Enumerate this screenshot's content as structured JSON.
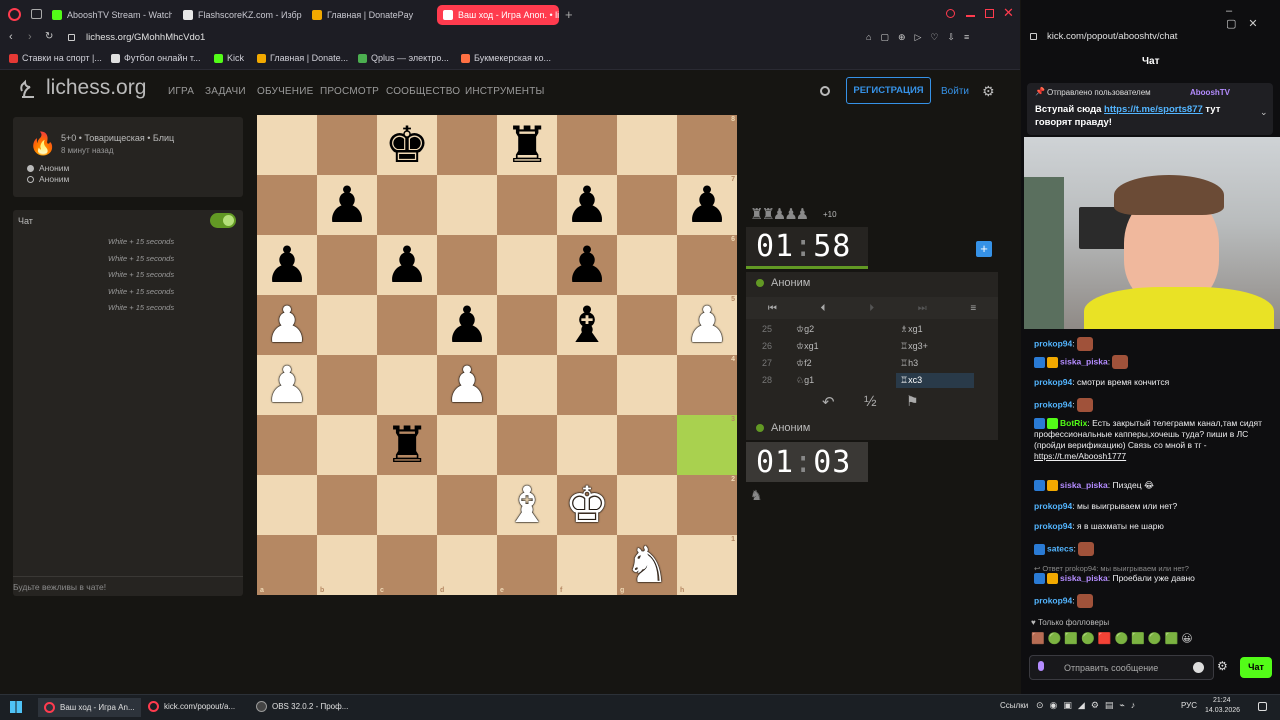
{
  "browser": {
    "tabs": [
      {
        "label": "AbooshTV Stream - Watch",
        "color": "#53fc18"
      },
      {
        "label": "FlashscoreKZ.com - Избр",
        "color": "#e8e8e8"
      },
      {
        "label": "Главная | DonatePay",
        "color": "#f2a900"
      },
      {
        "label": "Ваш ход - Игра Anon. • li",
        "color": "#ffffff"
      }
    ],
    "url": "lichess.org/GMohhMhcVdo1",
    "bookmarks": [
      {
        "label": "Ставки на спорт |...",
        "color": "#e53935"
      },
      {
        "label": "Футбол онлайн т...",
        "color": "#e0e0e0"
      },
      {
        "label": "Kick",
        "color": "#53fc18"
      },
      {
        "label": "Главная | Donate...",
        "color": "#f2a900"
      },
      {
        "label": "Qplus — электро...",
        "color": "#4caf50"
      },
      {
        "label": "Букмекерская ко...",
        "color": "#ff7043"
      }
    ]
  },
  "site": {
    "logo": "lichess.org",
    "nav": [
      "ИГРА",
      "ЗАДАЧИ",
      "ОБУЧЕНИЕ",
      "ПРОСМОТР",
      "СООБЩЕСТВО",
      "ИНСТРУМЕНТЫ"
    ],
    "register": "РЕГИСТРАЦИЯ",
    "login": "Войти"
  },
  "game": {
    "mode": "5+0 • Товарищеская • Блиц",
    "ago": "8 минут назад",
    "white": "Аноним",
    "black": "Аноним"
  },
  "chat": {
    "title": "Чат",
    "messages": [
      "White + 15 seconds",
      "White + 15 seconds",
      "White + 15 seconds",
      "White + 15 seconds",
      "White + 15 seconds"
    ],
    "placeholder": "Будьте вежливы в чате!"
  },
  "board": {
    "colors": {
      "light": "#f0d9b5",
      "dark": "#b58863",
      "highlight": "#a9d14f"
    },
    "highlight_square": "h3",
    "pieces": [
      {
        "sq": "c8",
        "p": "bK"
      },
      {
        "sq": "e8",
        "p": "bR"
      },
      {
        "sq": "b7",
        "p": "bP"
      },
      {
        "sq": "f7",
        "p": "bP"
      },
      {
        "sq": "h7",
        "p": "bP"
      },
      {
        "sq": "a6",
        "p": "bP"
      },
      {
        "sq": "c6",
        "p": "bP"
      },
      {
        "sq": "f6",
        "p": "bP"
      },
      {
        "sq": "a5",
        "p": "wP"
      },
      {
        "sq": "d5",
        "p": "bP"
      },
      {
        "sq": "f5",
        "p": "bB"
      },
      {
        "sq": "h5",
        "p": "wP"
      },
      {
        "sq": "a4",
        "p": "wP"
      },
      {
        "sq": "d4",
        "p": "wP"
      },
      {
        "sq": "c3",
        "p": "bR"
      },
      {
        "sq": "e2",
        "p": "wB"
      },
      {
        "sq": "f2",
        "p": "wK"
      },
      {
        "sq": "g1",
        "p": "wN"
      }
    ],
    "ranks": [
      "8",
      "7",
      "6",
      "5",
      "4",
      "3",
      "2",
      "1"
    ],
    "files": [
      "a",
      "b",
      "c",
      "d",
      "e",
      "f",
      "g",
      "h"
    ]
  },
  "panel": {
    "material_diff": "+10",
    "top_clock": {
      "mm": "01",
      "ss": "58"
    },
    "top_player": "Аноним",
    "bottom_player": "Аноним",
    "bottom_clock": {
      "mm": "01",
      "ss": "03"
    },
    "moves": [
      {
        "n": "25",
        "w": "♔g2",
        "b": "♗xg1"
      },
      {
        "n": "26",
        "w": "♔xg1",
        "b": "♖xg3+"
      },
      {
        "n": "27",
        "w": "♔f2",
        "b": "♖h3"
      },
      {
        "n": "28",
        "w": "♘g1",
        "b": "♖xc3"
      }
    ],
    "draw": "½"
  },
  "kick": {
    "url": "kick.com/popout/abooshtv/chat",
    "title": "Чат",
    "pinned_by": "Отправлено пользователем",
    "pinned_user": "AbooshTV",
    "pinned_text_1": "Вступай сюда",
    "pinned_link": "https://t.me/sports877",
    "pinned_text_2": "тут говорят правду!",
    "messages": [
      {
        "user": "prokop94",
        "text": ""
      },
      {
        "user": "siska_piska",
        "text": ""
      },
      {
        "user": "prokop94",
        "text": "смотри время кончится"
      },
      {
        "user": "prokop94",
        "text": ""
      },
      {
        "user": "BotRix",
        "text": "Есть закрытый телеграмм канал,там сидят профессиональные капперы,хочешь туда? пиши в ЛС (пройди верификацию) Связь со мной в тг -",
        "link": "https://t.me/Aboosh1777"
      },
      {
        "user": "siska_piska",
        "text": "Пиздец 😂"
      },
      {
        "user": "prokop94",
        "text": "мы выигрываем или нет?"
      },
      {
        "user": "prokop94",
        "text": "я в шахматы не шарю"
      },
      {
        "user": "satecs",
        "text": ""
      },
      {
        "user": "siska_piska",
        "text": "Проебали уже давно",
        "reply": "Ответ prokop94: мы выигрываем или нет?"
      },
      {
        "user": "prokop94",
        "text": ""
      }
    ],
    "followers_only": "Только фолловеры",
    "input_placeholder": "Отправить сообщение",
    "send": "Чат"
  },
  "taskbar": {
    "items": [
      "Ваш ход - Игра An...",
      "kick.com/popout/a...",
      "OBS 32.0.2 - Проф..."
    ],
    "links": "Ссылки",
    "lang": "РУС",
    "time": "21:24",
    "date": "14.03.2026"
  }
}
